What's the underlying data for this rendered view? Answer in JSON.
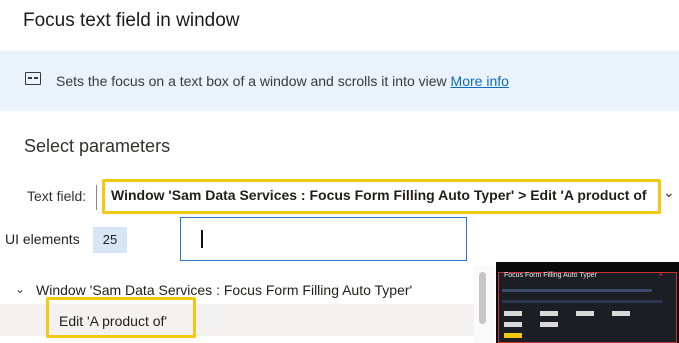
{
  "title": "Focus text field in window",
  "info": {
    "description": "Sets the focus on a text box of a window and scrolls it into view",
    "link": "More info"
  },
  "section_title": "Select parameters",
  "text_field": {
    "label": "Text field:",
    "value": "Window 'Sam Data Services : Focus Form Filling Auto Typer' > Edit 'A product of"
  },
  "ui_elements": {
    "label": "UI elements",
    "count": "25",
    "search_value": ""
  },
  "tree": {
    "parent": "Window 'Sam Data Services : Focus Form Filling Auto Typer'",
    "child": "Edit 'A product of'"
  },
  "preview": {
    "title": "Focus Form Filling Auto Typer"
  },
  "colors": {
    "highlight": "#f2c811",
    "info_bg": "#eaf2fb",
    "link": "#0f6cbd",
    "count_bg": "#d6e6f7"
  }
}
